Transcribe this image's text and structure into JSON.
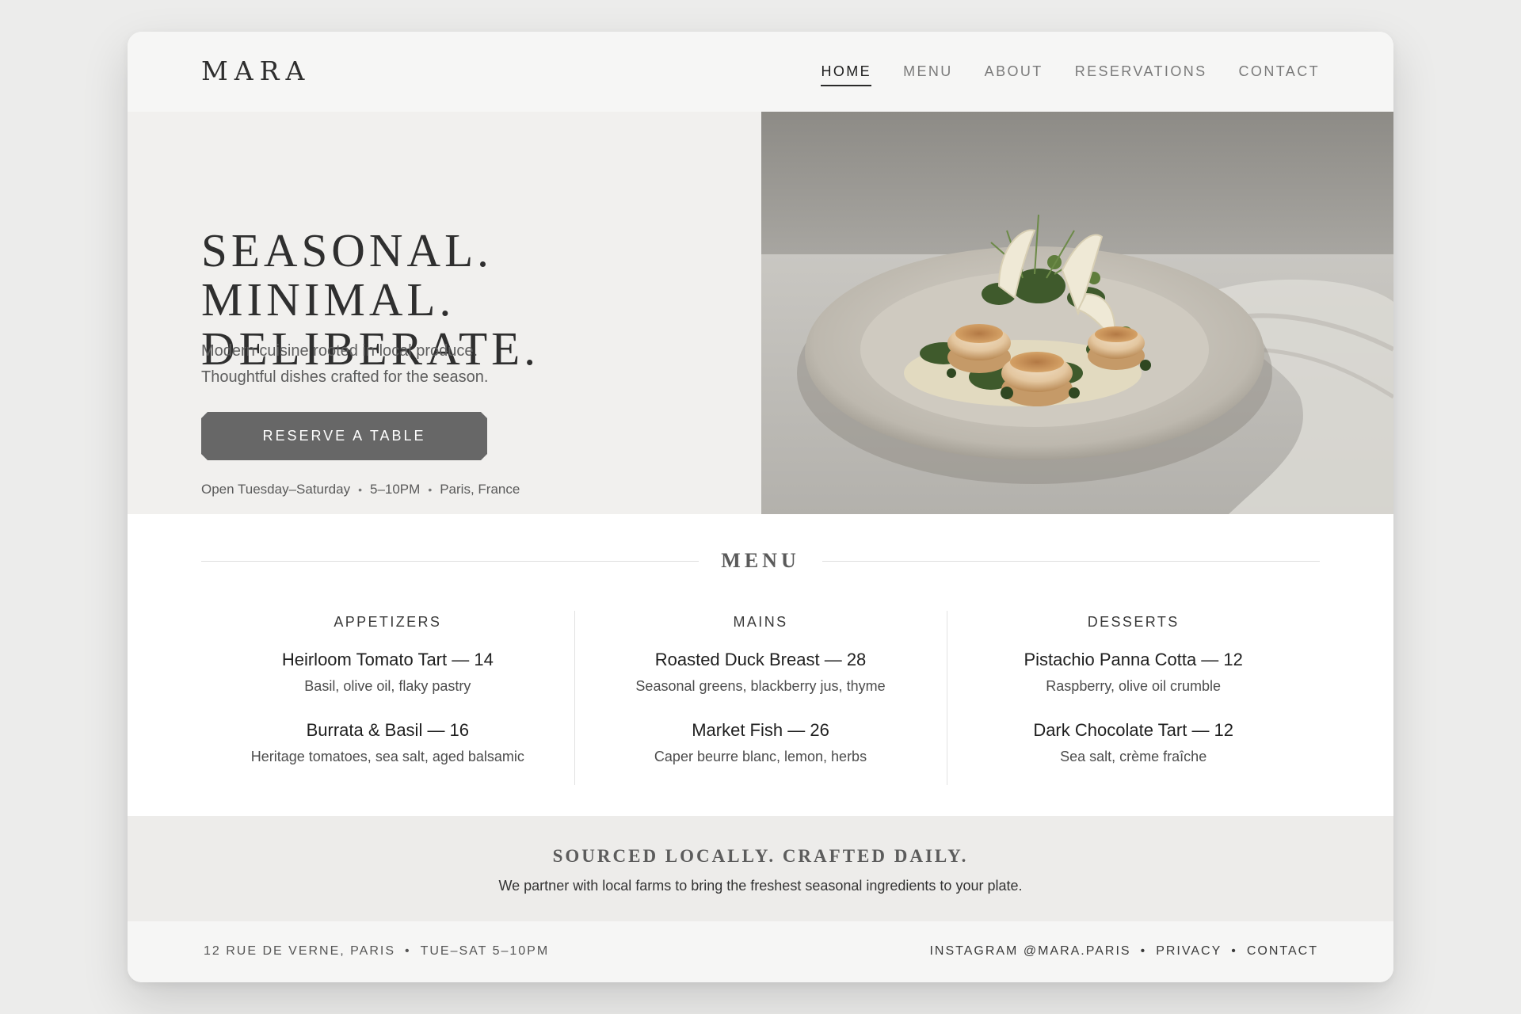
{
  "brand": {
    "logo": "MARA"
  },
  "nav": {
    "items": [
      {
        "label": "HOME",
        "active": true
      },
      {
        "label": "MENU",
        "active": false
      },
      {
        "label": "ABOUT",
        "active": false
      },
      {
        "label": "RESERVATIONS",
        "active": false
      },
      {
        "label": "CONTACT",
        "active": false
      }
    ]
  },
  "hero": {
    "title_line1": "SEASONAL. MINIMAL.",
    "title_line2": "DELIBERATE.",
    "subtitle_line1": "Modern cuisine rooted in local produce.",
    "subtitle_line2": "Thoughtful dishes crafted for the season.",
    "cta_label": "RESERVE A TABLE",
    "hours": "Open Tuesday–Saturday",
    "time": "5–10PM",
    "location": "Paris, France"
  },
  "menu": {
    "heading": "MENU",
    "columns": [
      {
        "title": "APPETIZERS",
        "dishes": [
          {
            "name": "Heirloom Tomato Tart — 14",
            "desc": "Basil, olive oil, flaky pastry"
          },
          {
            "name": "Burrata & Basil — 16",
            "desc": "Heritage tomatoes, sea salt, aged balsamic"
          }
        ]
      },
      {
        "title": "MAINS",
        "dishes": [
          {
            "name": "Roasted Duck Breast — 28",
            "desc": "Seasonal greens, blackberry jus, thyme"
          },
          {
            "name": "Market Fish — 26",
            "desc": "Caper beurre blanc, lemon, herbs"
          }
        ]
      },
      {
        "title": "DESSERTS",
        "dishes": [
          {
            "name": "Pistachio Panna Cotta — 12",
            "desc": "Raspberry, olive oil crumble"
          },
          {
            "name": "Dark Chocolate Tart — 12",
            "desc": "Sea salt, crème fraîche"
          }
        ]
      }
    ]
  },
  "sourced": {
    "title": "SOURCED LOCALLY. CRAFTED DAILY.",
    "text": "We partner with local farms to bring the freshest seasonal ingredients to your plate."
  },
  "footer": {
    "address": "12 RUE DE VERNE, PARIS",
    "hours": "TUE–SAT 5–10PM",
    "instagram": "INSTAGRAM @MARA.PARIS",
    "privacy": "PRIVACY",
    "contact": "CONTACT",
    "separator": "•"
  },
  "colors": {
    "page_bg": "#ececeb",
    "hero_bg": "#f1f0ee",
    "button_bg": "#676767",
    "text_dark": "#2b2b2b",
    "band_bg": "#edecea"
  }
}
